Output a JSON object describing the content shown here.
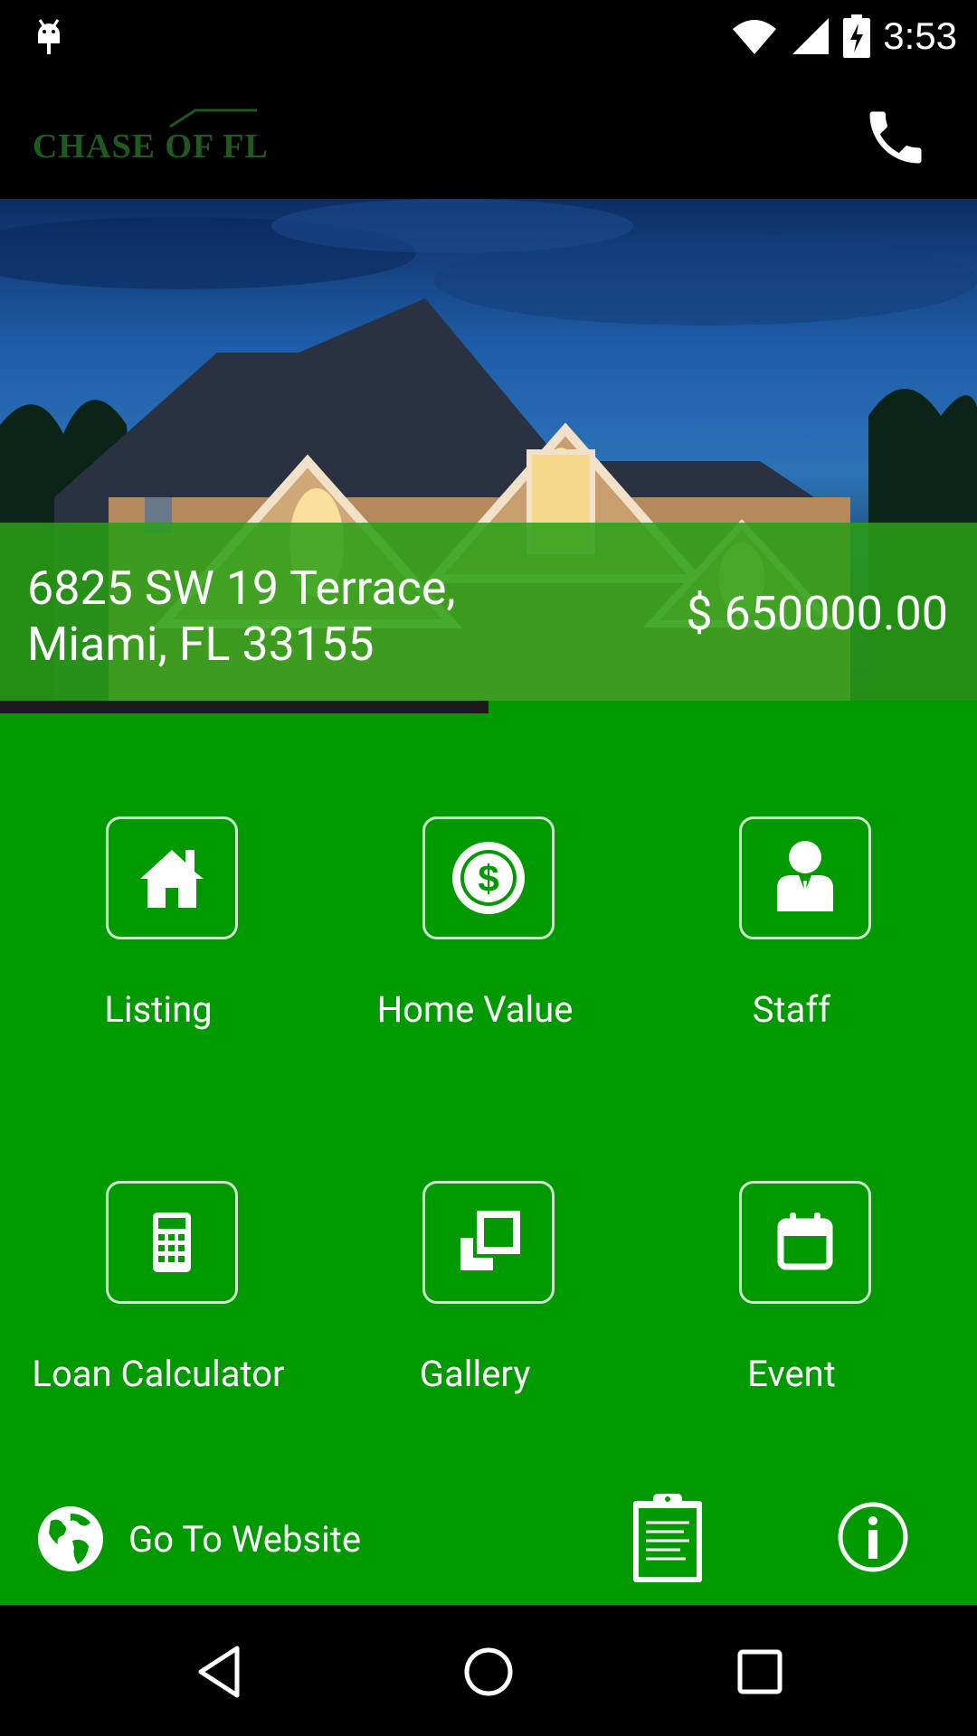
{
  "status_bar": {
    "time": "3:53",
    "icons": [
      "android-debug-icon",
      "wifi-icon",
      "signal-icon",
      "battery-charging-icon"
    ]
  },
  "app_bar": {
    "logo_text": "CHASE OF FL",
    "action_icon": "phone-icon"
  },
  "hero": {
    "address": "6825 SW 19 Terrace, Miami, FL 33155",
    "price": "$ 650000.00",
    "slide_progress": 0.5
  },
  "tiles": [
    {
      "label": "Listing",
      "icon": "home-icon"
    },
    {
      "label": "Home Value",
      "icon": "dollar-icon"
    },
    {
      "label": "Staff",
      "icon": "staff-person-icon"
    },
    {
      "label": "Loan Calculator",
      "icon": "calculator-icon"
    },
    {
      "label": "Gallery",
      "icon": "gallery-icon"
    },
    {
      "label": "Event",
      "icon": "calendar-icon"
    }
  ],
  "bottom_bar": {
    "website_label": "Go To Website",
    "website_icon": "globe-icon",
    "clipboard_icon": "clipboard-icon",
    "info_icon": "info-icon"
  },
  "nav_bar": {
    "buttons": [
      "back-icon",
      "home-circle-icon",
      "recents-icon"
    ]
  },
  "colors": {
    "primary_green": "#009900",
    "overlay_green": "#28a014",
    "logo_green": "#1f5a1f",
    "progress_dark": "#1a1a1a"
  }
}
